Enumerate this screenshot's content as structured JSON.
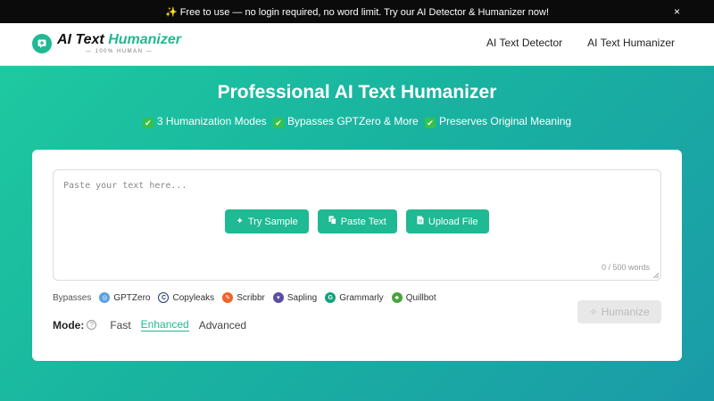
{
  "announcement": {
    "text": "✨ Free to use — no login required, no word limit. Try our AI Detector & Humanizer now!",
    "close": "×"
  },
  "header": {
    "logo_title_prefix": "AI Text ",
    "logo_title_accent": "Humanizer",
    "logo_subtitle": "— 100% HUMAN —",
    "nav": [
      "AI Text Detector",
      "AI Text Humanizer"
    ]
  },
  "hero": {
    "title": "Professional AI Text Humanizer",
    "features": [
      "3 Humanization Modes",
      "Bypasses GPTZero & More",
      "Preserves Original Meaning"
    ]
  },
  "editor": {
    "placeholder": "Paste your text here...",
    "buttons": [
      "Try Sample",
      "Paste Text",
      "Upload File"
    ],
    "word_count": "0 / 500 words"
  },
  "bypasses": {
    "label": "Bypasses",
    "brands": [
      {
        "name": "GPTZero",
        "color": "#5aa0e6"
      },
      {
        "name": "Copyleaks",
        "color": "#1b3a7a"
      },
      {
        "name": "Scribbr",
        "color": "#f0632a"
      },
      {
        "name": "Sapling",
        "color": "#5a4fa3"
      },
      {
        "name": "Grammarly",
        "color": "#15a07a"
      },
      {
        "name": "Quillbot",
        "color": "#4aa33e"
      }
    ]
  },
  "mode": {
    "label": "Mode:",
    "help": "?",
    "options": [
      "Fast",
      "Enhanced",
      "Advanced"
    ],
    "selected": "Enhanced"
  },
  "action": {
    "humanize_label": "Humanize"
  },
  "colors": {
    "accent": "#1fb993",
    "header_bg": "#0b0b0b"
  }
}
